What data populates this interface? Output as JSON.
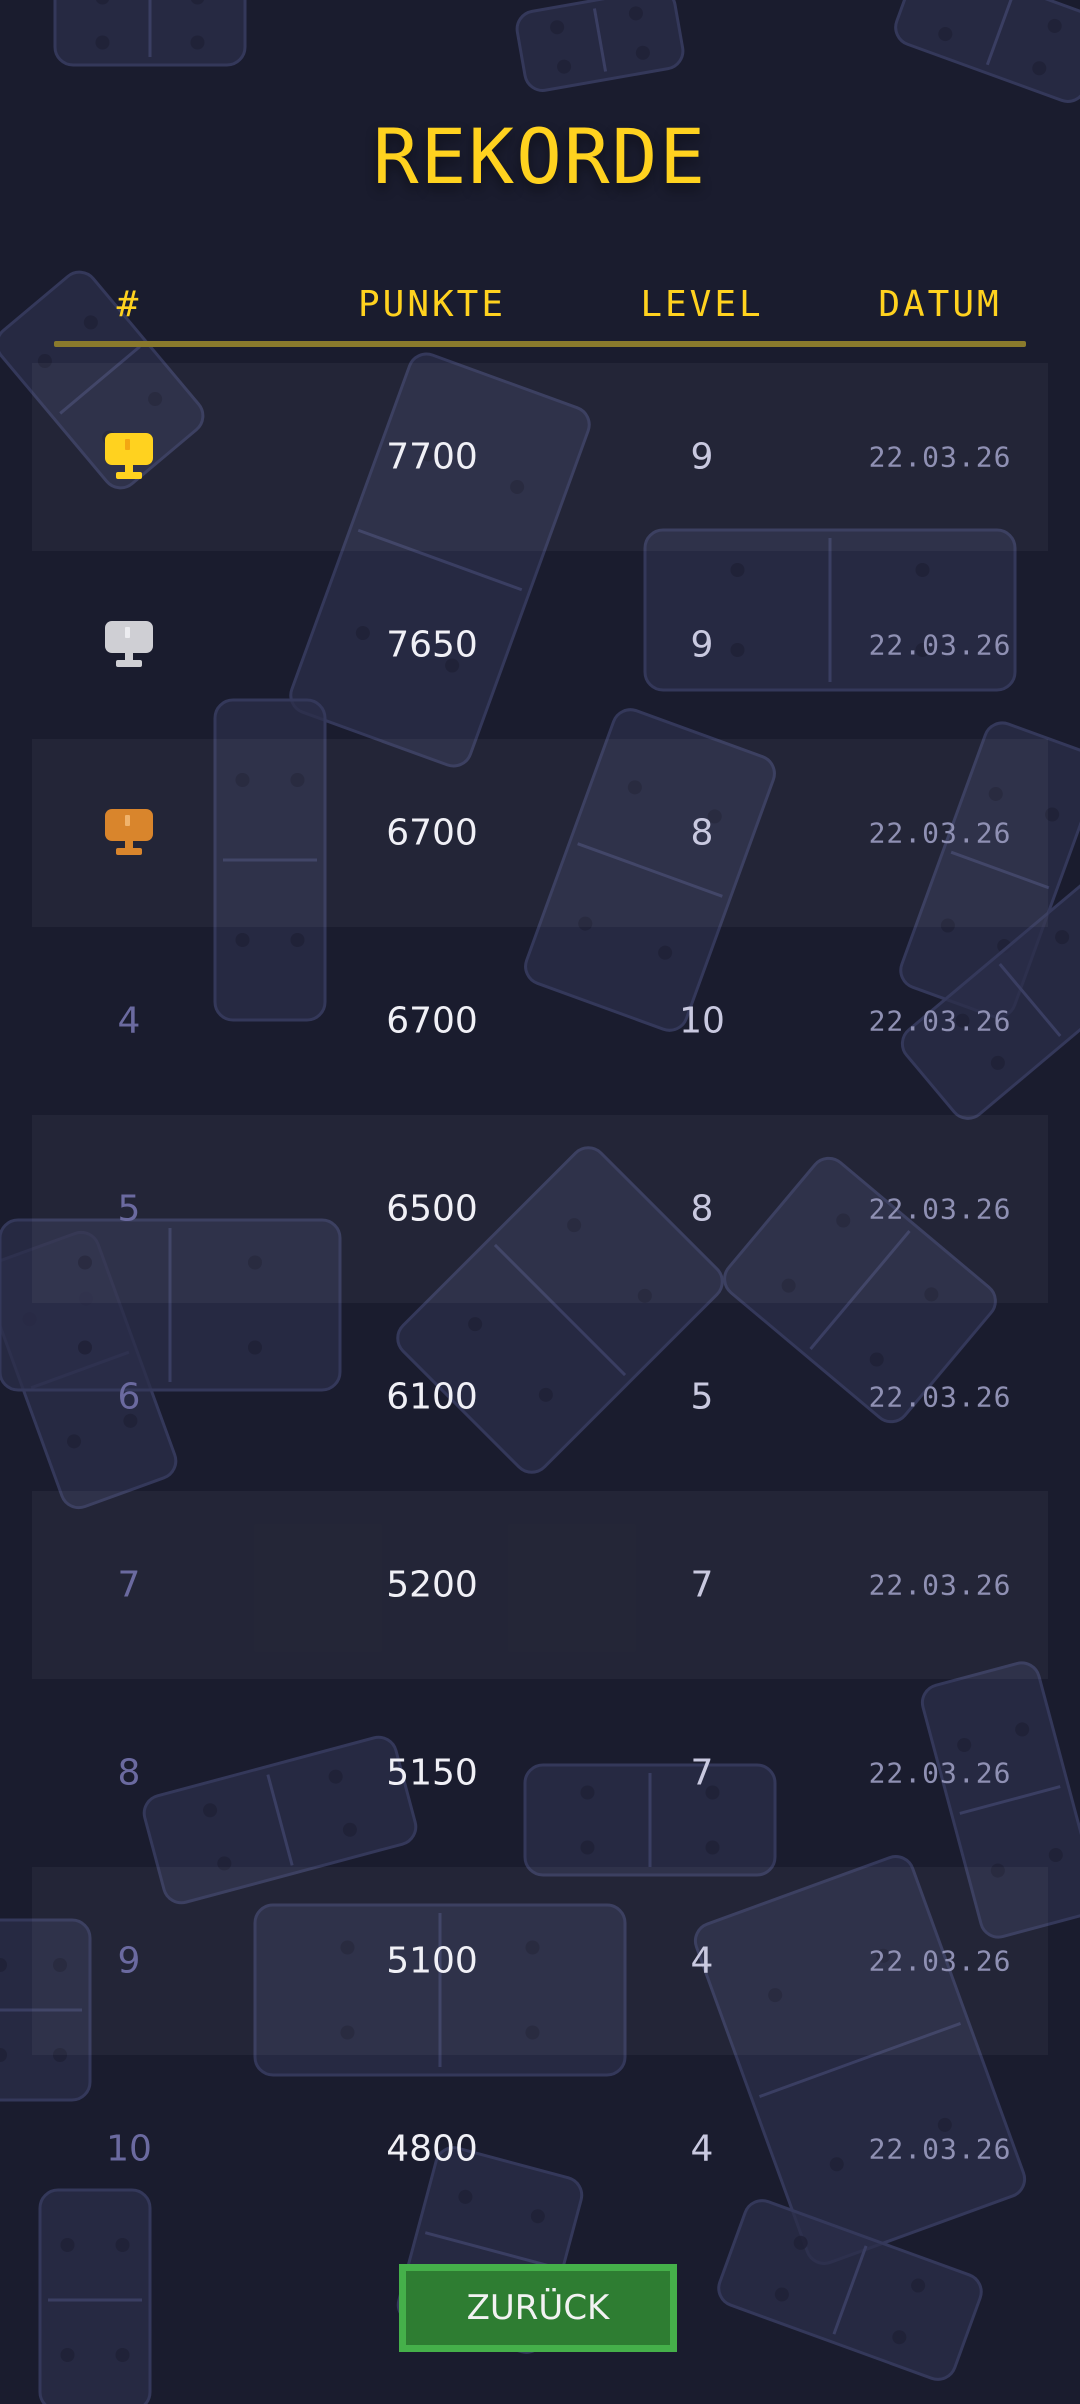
{
  "title": "REKORDE",
  "header": {
    "rank": "#",
    "points": "PUNKTE",
    "level": "LEVEL",
    "date": "DATUM"
  },
  "colors": {
    "background": "#1a1c2e",
    "accent": "#ffd21f",
    "gold": "#ffd21f",
    "silver": "#cfcfd4",
    "bronze": "#d9852c",
    "button": "#2e7d32",
    "button_border": "#45b04a"
  },
  "rows": [
    {
      "rank": "1",
      "medal": "gold-trophy-icon",
      "points": "7700",
      "level": "9",
      "date": "22.03.26"
    },
    {
      "rank": "2",
      "medal": "silver-trophy-icon",
      "points": "7650",
      "level": "9",
      "date": "22.03.26"
    },
    {
      "rank": "3",
      "medal": "bronze-trophy-icon",
      "points": "6700",
      "level": "8",
      "date": "22.03.26"
    },
    {
      "rank": "4",
      "medal": "",
      "points": "6700",
      "level": "10",
      "date": "22.03.26"
    },
    {
      "rank": "5",
      "medal": "",
      "points": "6500",
      "level": "8",
      "date": "22.03.26"
    },
    {
      "rank": "6",
      "medal": "",
      "points": "6100",
      "level": "5",
      "date": "22.03.26"
    },
    {
      "rank": "7",
      "medal": "",
      "points": "5200",
      "level": "7",
      "date": "22.03.26"
    },
    {
      "rank": "8",
      "medal": "",
      "points": "5150",
      "level": "7",
      "date": "22.03.26"
    },
    {
      "rank": "9",
      "medal": "",
      "points": "5100",
      "level": "4",
      "date": "22.03.26"
    },
    {
      "rank": "10",
      "medal": "",
      "points": "4800",
      "level": "4",
      "date": "22.03.26"
    }
  ],
  "back_button": "ZURÜCK"
}
